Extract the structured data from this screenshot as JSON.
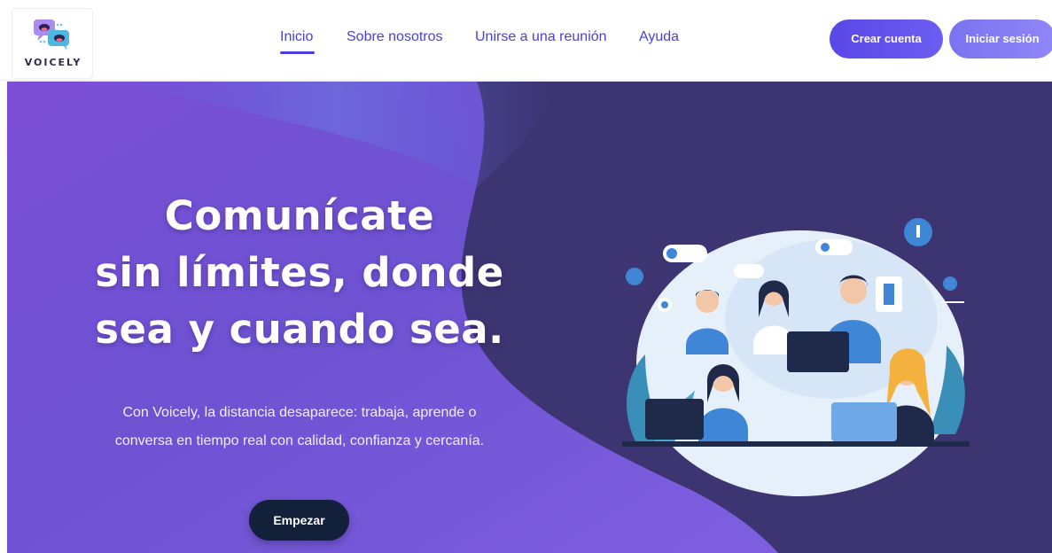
{
  "brand": {
    "name": "VOICELY"
  },
  "nav": {
    "items": [
      {
        "label": "Inicio",
        "active": true
      },
      {
        "label": "Sobre nosotros"
      },
      {
        "label": "Unirse a una reunión"
      },
      {
        "label": "Ayuda"
      }
    ]
  },
  "auth": {
    "create_label": "Crear cuenta",
    "login_label": "Iniciar sesión"
  },
  "hero": {
    "title_lines": [
      "Comunícate",
      "sin límites, donde",
      "sea y cuando sea."
    ],
    "subtitle": "Con Voicely, la distancia desaparece: trabaja, aprende o conversa en tiempo real con calidad, confianza y cercanía.",
    "cta_label": "Empezar"
  },
  "colors": {
    "accent": "#4a3fd8",
    "hero_dark": "#3d3472",
    "hero_purple": "#7a5ae0",
    "cta_dark": "#12203a"
  },
  "illustration": {
    "subject": "video-conference-illustration"
  }
}
